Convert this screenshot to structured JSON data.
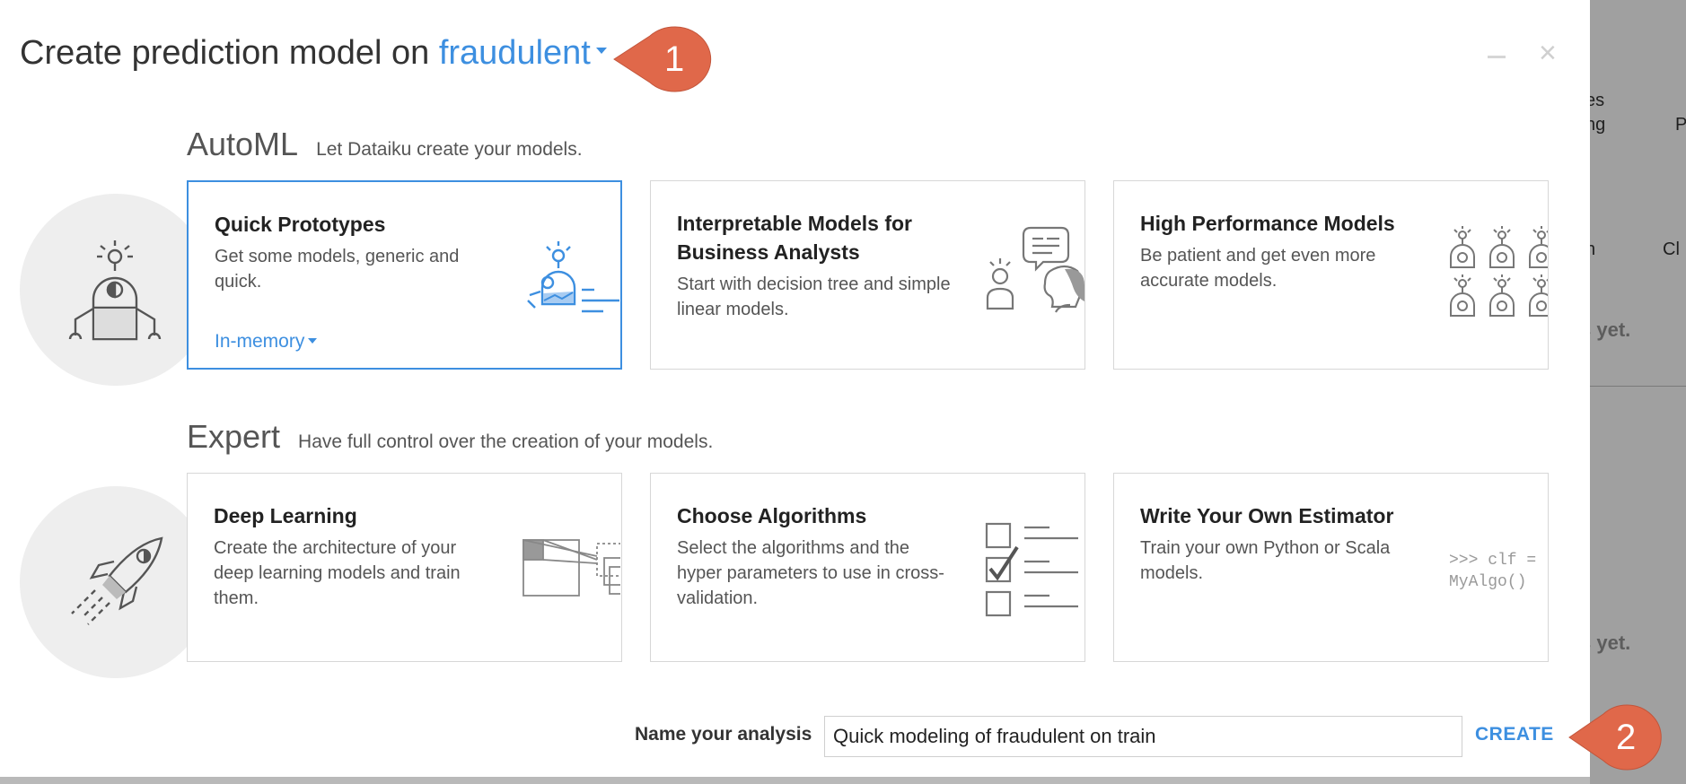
{
  "background": {
    "fragments": [
      "es",
      "ng",
      "P",
      "n",
      "Cl",
      "s yet.",
      "s yet."
    ]
  },
  "dialog": {
    "title_prefix": "Create prediction model on",
    "target_variable": "fraudulent",
    "minimize_icon": "minimize-icon",
    "close_icon": "close-icon"
  },
  "automl": {
    "heading": "AutoML",
    "subheading": "Let Dataiku create your models.",
    "cards": [
      {
        "title": "Quick Prototypes",
        "description": "Get some models, generic and quick.",
        "engine": "In-memory",
        "selected": true,
        "icon": "robot-prototype-icon"
      },
      {
        "title": "Interpretable Models for Business Analysts",
        "description": "Start with decision tree and simple linear models.",
        "icon": "analysts-speech-icon"
      },
      {
        "title": "High Performance Models",
        "description": "Be patient and get even more accurate models.",
        "icon": "robot-grid-icon"
      }
    ]
  },
  "expert": {
    "heading": "Expert",
    "subheading": "Have full control over the creation of your models.",
    "cards": [
      {
        "title": "Deep Learning",
        "description": "Create the architecture of your deep learning models and train them.",
        "icon": "neural-layers-icon"
      },
      {
        "title": "Choose Algorithms",
        "description": "Select the algorithms and the hyper parameters to use in cross-validation.",
        "icon": "checklist-icon"
      },
      {
        "title": "Write Your Own Estimator",
        "description": "Train your own Python or Scala models.",
        "code_line1": ">>> clf =",
        "code_line2": "MyAlgo()",
        "icon": "code-icon"
      }
    ]
  },
  "footer": {
    "name_label": "Name your analysis",
    "name_value": "Quick modeling of fraudulent on train",
    "create_label": "CREATE"
  },
  "callouts": [
    "1",
    "2"
  ],
  "colors": {
    "accent": "#3d8fe0",
    "callout": "#e0684a",
    "circle": "#eeeeee",
    "backdrop": "#a0a0a0"
  }
}
